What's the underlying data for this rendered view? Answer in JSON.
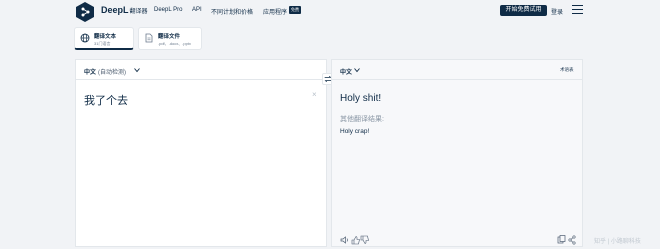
{
  "header": {
    "brand": "DeepL",
    "brand_sub": "翻译器",
    "nav": [
      "DeepL Pro",
      "API",
      "不同计划和价格",
      "应用程序"
    ],
    "badge": "免费",
    "cta": "开始免费试用",
    "login": "登录"
  },
  "tabs": [
    {
      "title": "翻译文本",
      "sub": "31门语言"
    },
    {
      "title": "翻译文件",
      "sub": ".pdf、.docx、.pptx"
    }
  ],
  "source": {
    "lang": "中文",
    "detect": "(自动检测)",
    "text": "我了个去"
  },
  "target": {
    "lang": "中文",
    "glossary": "术语表",
    "text": "Holy shit!",
    "alternatives_label": "其他翻译结果:",
    "alternatives": [
      "Holy crap!"
    ]
  },
  "watermark": "知乎  |  小路聊科技",
  "icons": {
    "logo": "deepl-logo",
    "globe": "globe-icon",
    "document": "document-icon",
    "swap": "swap-icon",
    "menu": "hamburger-menu-icon"
  },
  "colors": {
    "brand": "#0f2b46",
    "background": "#f1f3f6"
  }
}
